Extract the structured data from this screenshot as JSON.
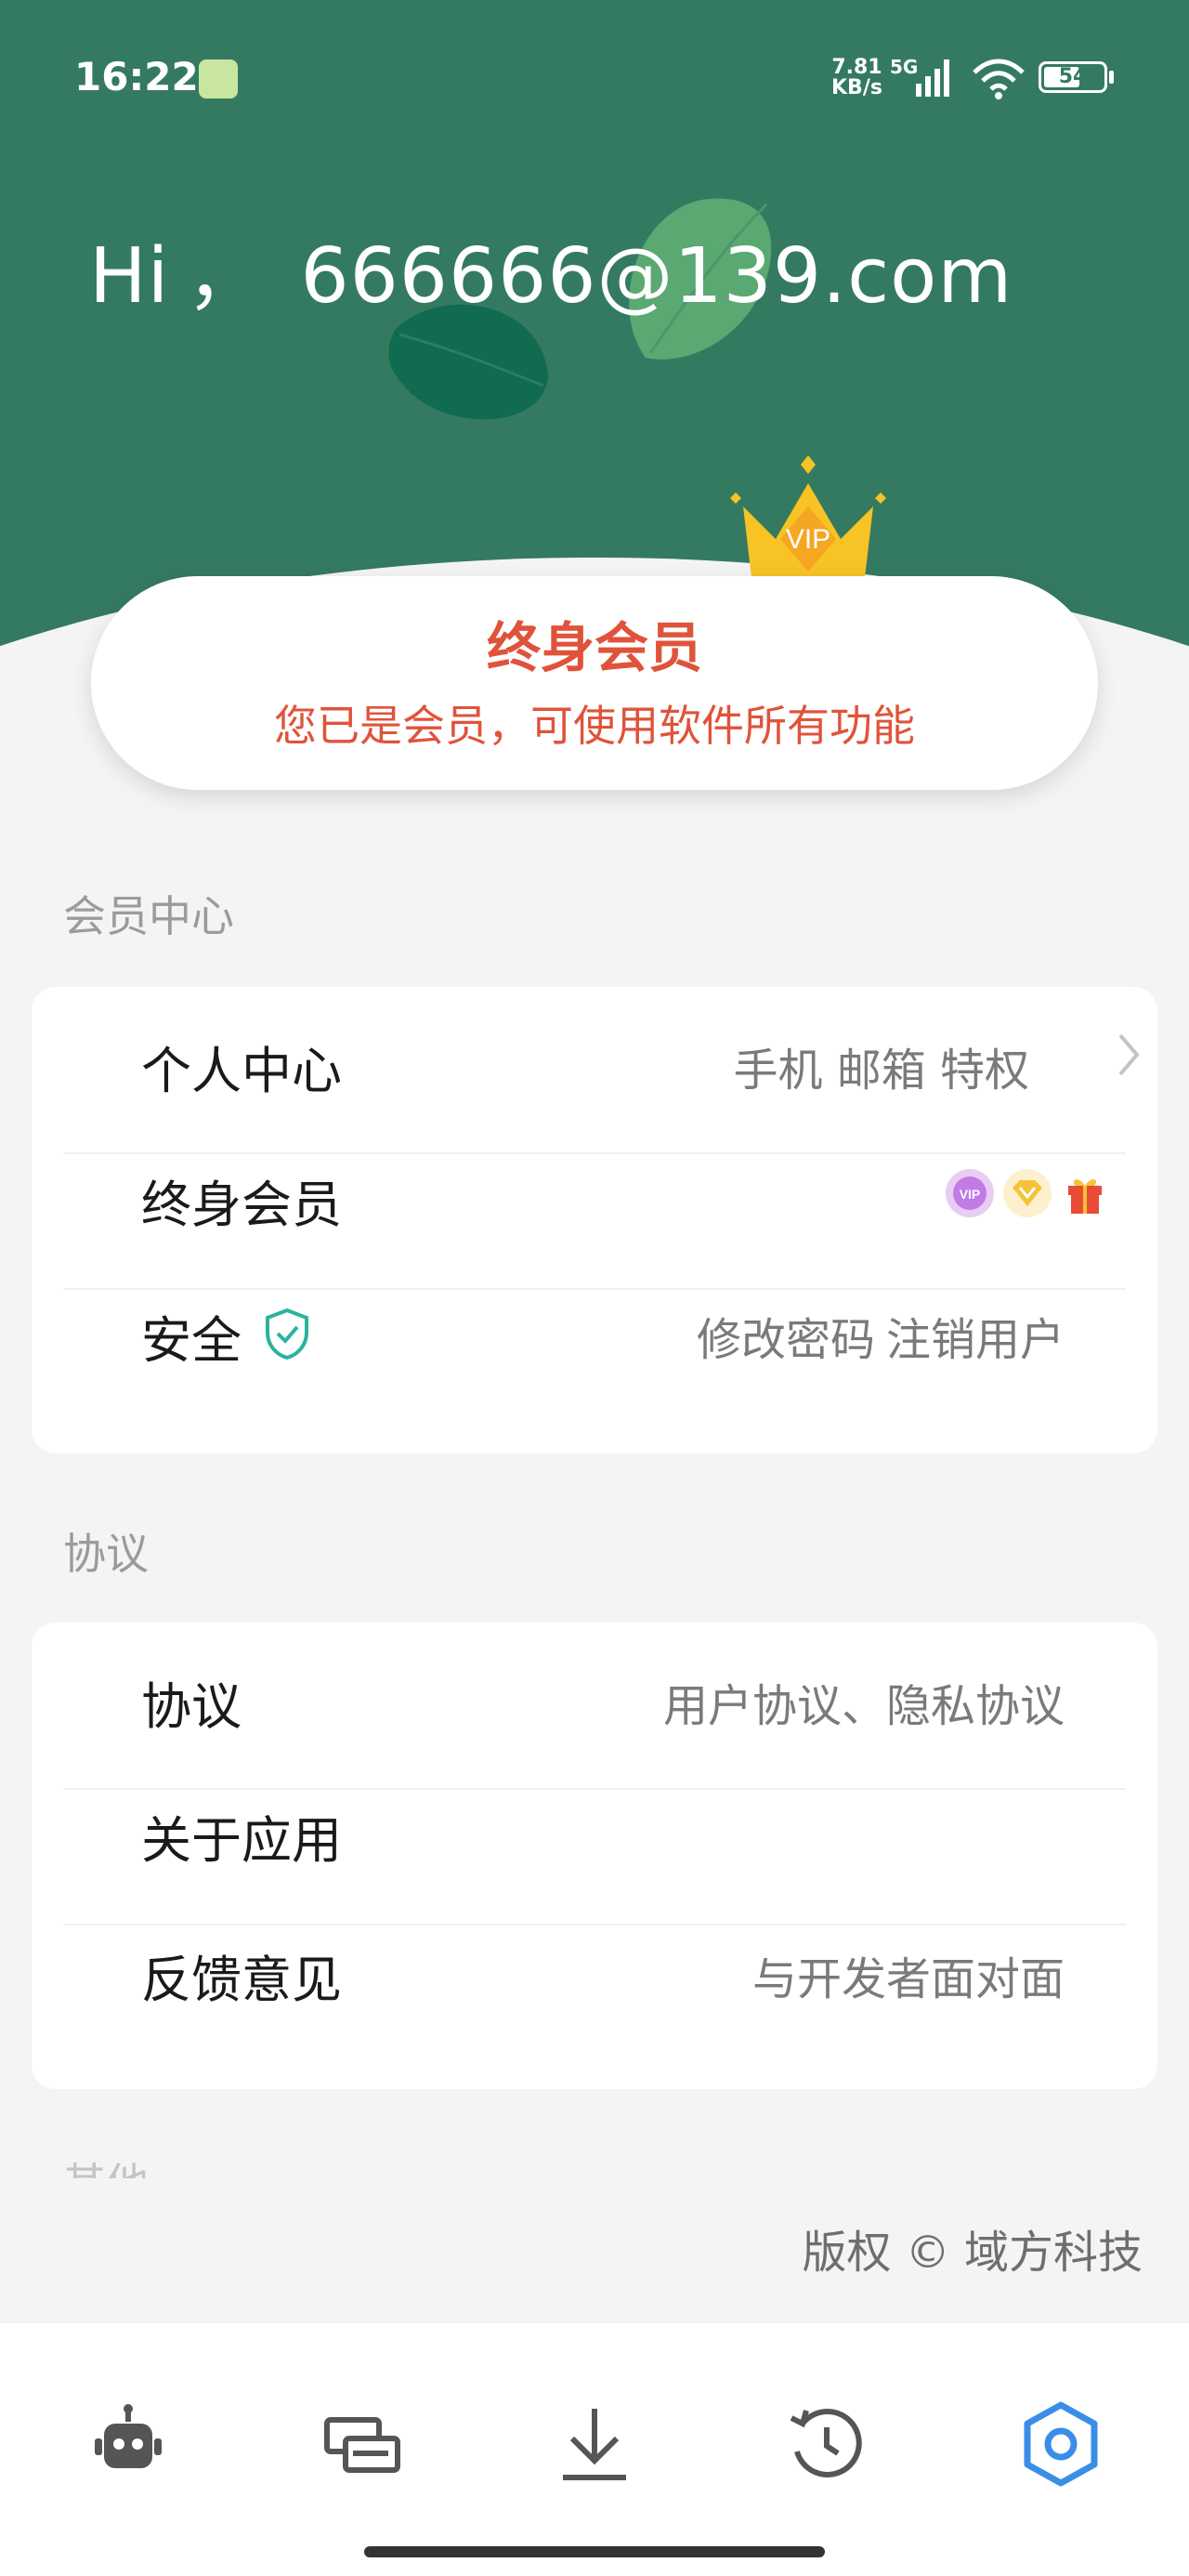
{
  "status_bar": {
    "time": "16:22",
    "net_speed_value": "7.81",
    "net_speed_unit": "KB/s",
    "network_type": "5G",
    "battery": "54"
  },
  "header": {
    "greeting_prefix": "Hi",
    "greeting_separator": "，",
    "email": "666666@139.com",
    "crown_text": "VIP",
    "bg_color": "#347a61"
  },
  "vip_card": {
    "title": "终身会员",
    "subtitle": "您已是会员，可使用软件所有功能",
    "accent_color": "#e0533b"
  },
  "member_section": {
    "label": "会员中心",
    "rows": [
      {
        "label": "个人中心",
        "value": "手机 邮箱 特权",
        "icon": "chevron-right-icon"
      },
      {
        "label": "终身会员",
        "badges": [
          "vip-badge-icon",
          "diamond-icon",
          "gift-icon"
        ],
        "badge_text": "VIP"
      },
      {
        "label": "安全",
        "icon": "shield-check-icon",
        "actions": [
          "修改密码",
          "注销用户"
        ]
      }
    ]
  },
  "agreement_section": {
    "label": "协议",
    "rows": [
      {
        "label": "协议",
        "value": "用户协议、隐私协议"
      },
      {
        "label": "关于应用",
        "value": ""
      },
      {
        "label": "反馈意见",
        "value": "与开发者面对面"
      }
    ]
  },
  "other_section": {
    "label": "其他"
  },
  "footer": {
    "copyright": "版权 © 域方科技"
  },
  "bottom_nav": {
    "items": [
      {
        "icon": "robot-icon",
        "active": false
      },
      {
        "icon": "cards-icon",
        "active": false
      },
      {
        "icon": "download-icon",
        "active": false
      },
      {
        "icon": "history-icon",
        "active": false
      },
      {
        "icon": "settings-icon",
        "active": true
      }
    ],
    "active_color": "#3a8ee6",
    "inactive_color": "#555555"
  }
}
